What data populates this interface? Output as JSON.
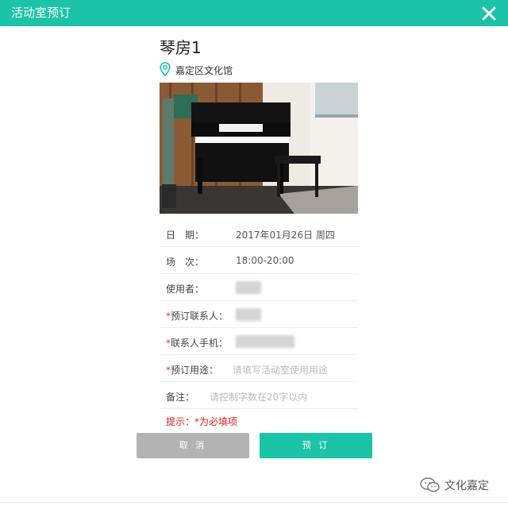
{
  "titlebar": {
    "title": "活动室预订",
    "close_icon": "close-icon"
  },
  "room": {
    "name": "琴房1",
    "location": "嘉定区文化馆",
    "location_icon": "map-pin-icon"
  },
  "photo": {
    "subject": "piano-room-photo"
  },
  "form": {
    "date": {
      "label": "日　期：",
      "value": "2017年01月26日 周四"
    },
    "session": {
      "label": "场　次：",
      "value": "18:00-20:00"
    },
    "user": {
      "label": "使用者："
    },
    "contact": {
      "required_mark": "*",
      "label": "预订联系人："
    },
    "phone": {
      "required_mark": "*",
      "label": "联系人手机："
    },
    "purpose": {
      "required_mark": "*",
      "label": "预订用途：",
      "placeholder": "请填写活动室使用用途"
    },
    "remark": {
      "label": "备注：",
      "placeholder": "请控制字数在20字以内"
    }
  },
  "hint": "提示：*为必填项",
  "buttons": {
    "cancel": "取 消",
    "book": "预 订"
  },
  "watermark": {
    "text": "文化嘉定",
    "icon": "wechat-icon"
  },
  "colors": {
    "accent": "#1bc4a6",
    "required": "#e0403c",
    "cancel_button": "#b3b3b3"
  }
}
